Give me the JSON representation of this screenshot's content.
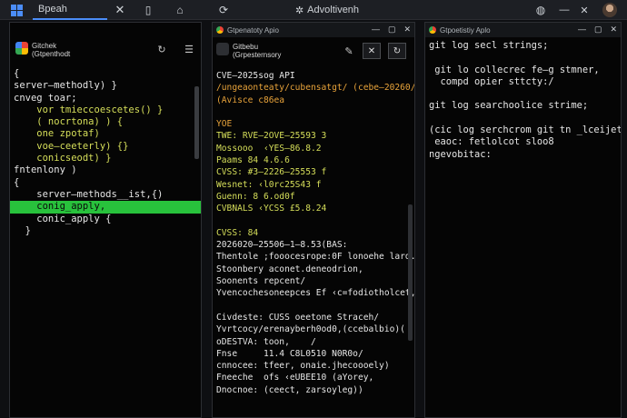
{
  "taskbar": {
    "search_text": "Bpeah",
    "window_title": "Advoltivenh"
  },
  "left": {
    "app_name_1": "Gitchek",
    "app_name_2": "(Gtpenthodt",
    "lines": [
      {
        "text": "{",
        "color": "white"
      },
      {
        "text": "server–methodly) }",
        "color": "white"
      },
      {
        "text": "cnveg toar;",
        "color": "white"
      },
      {
        "text": "    vor tmieccoescetes() }",
        "color": "yellow"
      },
      {
        "text": "    ( nocrtona) ) {",
        "color": "yellow"
      },
      {
        "text": "    one zpotaf)",
        "color": "yellow"
      },
      {
        "text": "    voe–ceeterly) {}",
        "color": "yellow"
      },
      {
        "text": "    conicseodt) }",
        "color": "yellow"
      },
      {
        "text": "fntenlony )",
        "color": "white"
      },
      {
        "text": "{",
        "color": "white"
      },
      {
        "text": "    server–methods__ist,{)",
        "color": "white"
      },
      {
        "text": "    conig_apply,",
        "color": "hl"
      },
      {
        "text": "    conic_apply {",
        "color": "white"
      },
      {
        "text": "  }",
        "color": "white"
      }
    ]
  },
  "mid": {
    "title": "Gtpenatoty Apio",
    "app_name_1": "Gitbebu",
    "app_name_2": "(Grpesternsory",
    "lines": [
      {
        "text": "CVE–2025sog API",
        "color": "white"
      },
      {
        "text": "/ungeaonteaty/cubensatgt/ (cebe–20260/225535",
        "color": "orange"
      },
      {
        "text": "(Avisce c86ea",
        "color": "orange"
      },
      {
        "text": "",
        "color": "white"
      },
      {
        "text": "YOE",
        "color": "orange"
      },
      {
        "text": "TWE: RVE–2OVE–25593 3",
        "color": "yellow"
      },
      {
        "text": "Mossooo  ‹YES–86.8.2",
        "color": "yellow"
      },
      {
        "text": "Paams 84 4.6.6",
        "color": "yellow"
      },
      {
        "text": "CVSS: #3–2226–25553 f",
        "color": "yellow"
      },
      {
        "text": "Wesnet: ‹l0rc25S43 f",
        "color": "yellow"
      },
      {
        "text": "Guenn: 8 6.od0f",
        "color": "yellow"
      },
      {
        "text": "CVBNALS ‹YCSS £5.8.24",
        "color": "yellow"
      },
      {
        "text": "",
        "color": "white"
      },
      {
        "text": "CVSS: 84",
        "color": "yellow"
      },
      {
        "text": "2026020–25506–1–8.53(BAS:",
        "color": "white"
      },
      {
        "text": "Thentole ;fooocesrope:0F lonoehe lard.",
        "color": "white"
      },
      {
        "text": "Stoonbery aconet.deneodrion,",
        "color": "white"
      },
      {
        "text": "Soonents repcent/",
        "color": "white"
      },
      {
        "text": "Yvencochesoneepces Ef ‹c=fodiotholcet,,",
        "color": "white"
      },
      {
        "text": "",
        "color": "white"
      },
      {
        "text": "Civdeste: CUSS oeetone Straceh/",
        "color": "white"
      },
      {
        "text": "Yvrtcocy/erenayberh0od0,(ccebalbio)(",
        "color": "white"
      },
      {
        "text": "oDESTVA: toon,    /",
        "color": "white"
      },
      {
        "text": "Fnse     11.4 C8L0510 N0R0o/",
        "color": "white"
      },
      {
        "text": "cnnocee: tfeer, onaie.jhecoooely)",
        "color": "white"
      },
      {
        "text": "Fneeche  ofs ‹eUBEE10 (aYorey,",
        "color": "white"
      },
      {
        "text": "Dnocnoe: (ceect, zarsoyleg))",
        "color": "white"
      }
    ]
  },
  "right": {
    "title": "Gtpoetistiy Aplo",
    "lines": [
      {
        "text": "git log secl strings;",
        "color": "white"
      },
      {
        "text": "",
        "color": "white"
      },
      {
        "text": " git lo collecrec fe–g stmner,",
        "color": "white"
      },
      {
        "text": "  compd opier sttcty:/",
        "color": "white"
      },
      {
        "text": "",
        "color": "white"
      },
      {
        "text": "git log searchoolice strime;",
        "color": "white"
      },
      {
        "text": "",
        "color": "white"
      },
      {
        "text": "(cic log serchcrom git tn _lceijet,",
        "color": "white"
      },
      {
        "text": " eaoc: fetlolcot sloo8",
        "color": "white"
      },
      {
        "text": "ngevobitac:",
        "color": "white"
      }
    ]
  }
}
